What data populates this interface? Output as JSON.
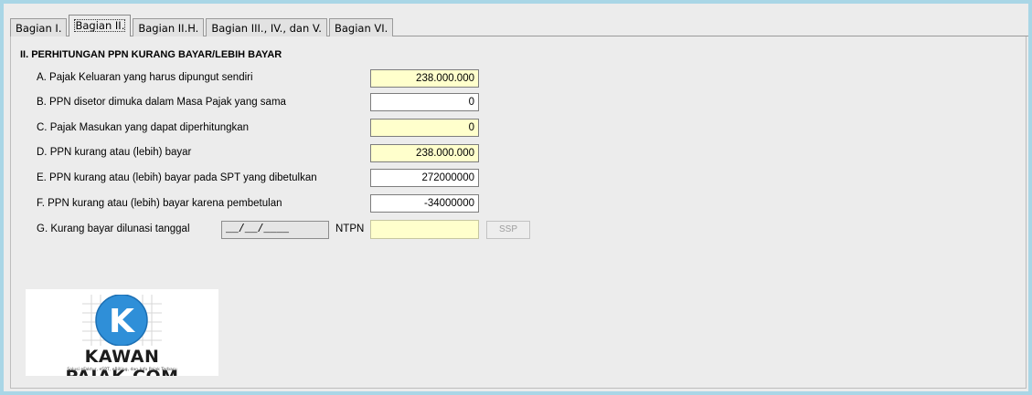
{
  "tabs": [
    {
      "label": "Bagian I."
    },
    {
      "label": "Bagian II."
    },
    {
      "label": "Bagian II.H."
    },
    {
      "label": "Bagian III., IV., dan V."
    },
    {
      "label": "Bagian VI."
    }
  ],
  "active_tab": "Bagian II.",
  "section": {
    "title": "II. PERHITUNGAN PPN KURANG BAYAR/LEBIH BAYAR"
  },
  "rows": [
    {
      "label": "A. Pajak Keluaran yang harus dipungut sendiri",
      "value": "238.000.000"
    },
    {
      "label": "B. PPN disetor dimuka dalam Masa Pajak yang sama",
      "value": "0"
    },
    {
      "label": "C. Pajak Masukan yang dapat diperhitungkan",
      "value": "0"
    },
    {
      "label": "D. PPN kurang atau (lebih) bayar",
      "value": "238.000.000"
    },
    {
      "label": "E. PPN kurang atau (lebih) bayar pada SPT yang dibetulkan",
      "value": "272000000"
    },
    {
      "label": "F. PPN kurang atau (lebih) bayar karena pembetulan",
      "value": "-34000000"
    }
  ],
  "payment": {
    "label": "G. Kurang bayar dilunasi tanggal",
    "date_value": "__/__/____",
    "ntpn_label": "NTPN",
    "ntpn_value": "",
    "ssp_button": "SSP"
  },
  "logo": {
    "text": "KAWAN PAJAK.COM",
    "tagline": "Solusi eFaktur, eSPT, eBilling, dan Info Pajak Terbaru",
    "mark": "K"
  },
  "colors": {
    "readonly_field": "#ffffcc",
    "editable_field": "#ffffff",
    "window_border": "#a9d6e6",
    "logo_blue": "#2f8fd8"
  }
}
